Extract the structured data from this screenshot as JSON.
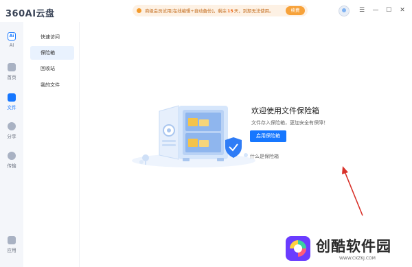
{
  "app": {
    "logo_text": "360AI云盘"
  },
  "promo": {
    "text_before": "商级会员试用[在线编辑+自动备份]，剩余",
    "days": "15",
    "text_after": "天，到期无法使用。",
    "renew_label": "续费"
  },
  "rail": {
    "items": [
      {
        "label": "AI",
        "icon": "ai-icon"
      },
      {
        "label": "首页",
        "icon": "home-icon"
      },
      {
        "label": "文件",
        "icon": "folder-icon"
      },
      {
        "label": "分享",
        "icon": "share-icon"
      },
      {
        "label": "传输",
        "icon": "transfer-icon"
      },
      {
        "label": "应用",
        "icon": "apps-icon"
      }
    ]
  },
  "subnav": {
    "items": [
      {
        "label": "快速访问"
      },
      {
        "label": "保险箱"
      },
      {
        "label": "回收站"
      },
      {
        "label": "我的文件"
      }
    ]
  },
  "vault": {
    "title": "欢迎使用文件保险箱",
    "subtitle": "文件存入保险箱，更加安全有保障！",
    "enable_label": "启用保险箱",
    "help_link": "什么是保险箱"
  },
  "watermark": {
    "title": "创酷软件园",
    "url": "WWW.CKZKJ.COM"
  },
  "colors": {
    "accent": "#1677ff",
    "promo_bg": "#fdf1e4",
    "arrow": "#d8322a"
  }
}
